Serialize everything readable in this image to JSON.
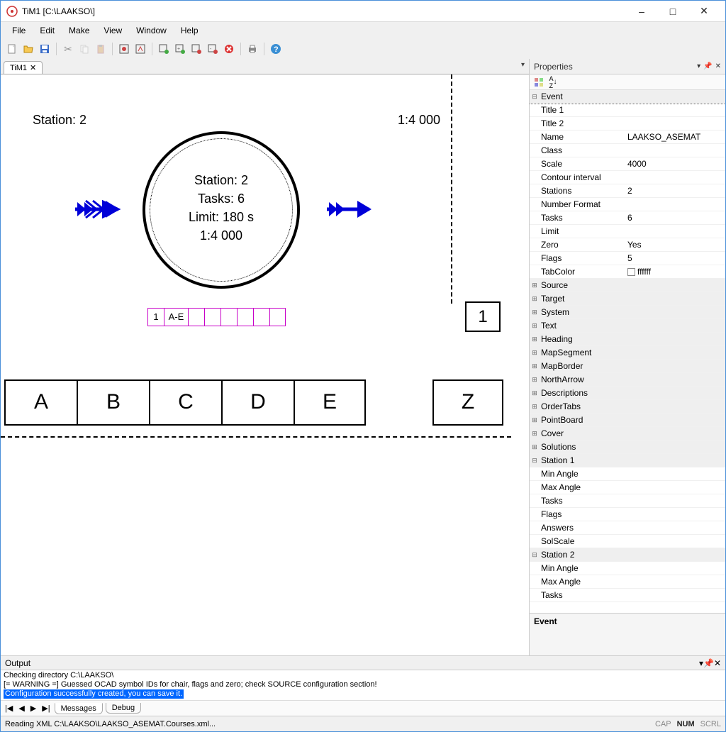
{
  "window": {
    "title": "TiM1 [C:\\LAAKSO\\]"
  },
  "menu": {
    "items": [
      "File",
      "Edit",
      "Make",
      "View",
      "Window",
      "Help"
    ]
  },
  "doc_tab": {
    "label": "TiM1"
  },
  "canvas": {
    "station_label": "Station: 2",
    "scale_label": "1:4 000",
    "circle": {
      "l1": "Station: 2",
      "l2": "Tasks: 6",
      "l3": "Limit: 180 s",
      "l4": "1:4 000"
    },
    "grid_first": "1",
    "grid_second": "A-E",
    "one_box": "1",
    "letters": [
      "A",
      "B",
      "C",
      "D",
      "E"
    ],
    "z": "Z"
  },
  "properties": {
    "title": "Properties",
    "desc_title": "Event",
    "event_rows": [
      {
        "k": "Title 1",
        "v": ""
      },
      {
        "k": "Title 2",
        "v": ""
      },
      {
        "k": "Name",
        "v": "LAAKSO_ASEMAT"
      },
      {
        "k": "Class",
        "v": ""
      },
      {
        "k": "Scale",
        "v": "4000"
      },
      {
        "k": "Contour interval",
        "v": ""
      },
      {
        "k": "Stations",
        "v": "2"
      },
      {
        "k": "Number Format",
        "v": ""
      },
      {
        "k": "Tasks",
        "v": "6"
      },
      {
        "k": "Limit",
        "v": ""
      },
      {
        "k": "Zero",
        "v": "Yes"
      },
      {
        "k": "Flags",
        "v": "5"
      },
      {
        "k": "TabColor",
        "v": "ffffff",
        "color": true
      }
    ],
    "closed_cats": [
      "Source",
      "Target",
      "System",
      "Text",
      "Heading",
      "MapSegment",
      "MapBorder",
      "NorthArrow",
      "Descriptions",
      "OrderTabs",
      "PointBoard",
      "Cover",
      "Solutions"
    ],
    "station1": {
      "name": "Station 1",
      "rows": [
        "Min Angle",
        "Max Angle",
        "Tasks",
        "Flags",
        "Answers",
        "SolScale"
      ]
    },
    "station2": {
      "name": "Station 2",
      "rows": [
        "Min Angle",
        "Max Angle",
        "Tasks"
      ]
    }
  },
  "output": {
    "title": "Output",
    "lines": [
      "Checking directory C:\\LAAKSO\\",
      "[= WARNING =] Guessed OCAD symbol IDs for chair, flags and zero; check SOURCE configuration section!"
    ],
    "success": "Configuration successfully created, you can save it.",
    "tabs": {
      "messages": "Messages",
      "debug": "Debug"
    }
  },
  "status": {
    "text": "Reading XML C:\\LAAKSO\\LAAKSO_ASEMAT.Courses.xml...",
    "cap": "CAP",
    "num": "NUM",
    "scrl": "SCRL"
  }
}
